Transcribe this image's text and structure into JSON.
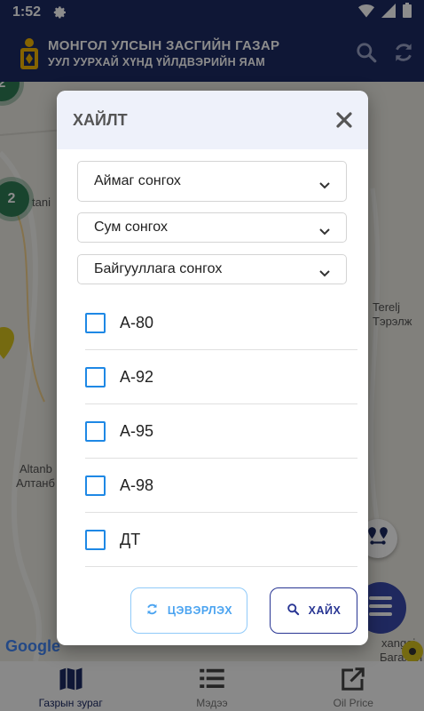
{
  "status_bar": {
    "time": "1:52"
  },
  "header": {
    "title": "МОНГОЛ УЛСЫН ЗАСГИЙН ГАЗАР",
    "subtitle": "УУЛ УУРХАЙ ХҮНД ҮЙЛДВЭРИЙН ЯАМ",
    "icons": [
      "search-icon",
      "refresh-icon"
    ]
  },
  "map": {
    "labels": [
      "tani",
      "Terelj",
      "Тэрэлж",
      "Altanb",
      "Алтанб",
      "xangai",
      "Багахан"
    ],
    "clusters": [
      "2",
      "2"
    ],
    "google": "Google"
  },
  "dialog": {
    "title": "ХАЙЛТ",
    "selects": [
      {
        "label": "Аймаг сонгох"
      },
      {
        "label": "Сум сонгох"
      },
      {
        "label": "Байгууллага сонгох"
      }
    ],
    "fuel_types": [
      {
        "label": "A-80",
        "checked": false
      },
      {
        "label": "A-92",
        "checked": false
      },
      {
        "label": "A-95",
        "checked": false
      },
      {
        "label": "A-98",
        "checked": false
      },
      {
        "label": "ДТ",
        "checked": false
      }
    ],
    "clear_label": "ЦЭВЭРЛЭХ",
    "search_label": "ХАЙХ"
  },
  "bottom_nav": {
    "items": [
      {
        "label": "Газрын зураг",
        "icon": "map-icon",
        "active": true
      },
      {
        "label": "Мэдээ",
        "icon": "list-icon",
        "active": false
      },
      {
        "label": "Oil Price",
        "icon": "open-external-icon",
        "active": false
      }
    ]
  },
  "colors": {
    "primary": "#1d2a63",
    "accent": "#1e88e5",
    "cluster": "#2f7d55"
  }
}
